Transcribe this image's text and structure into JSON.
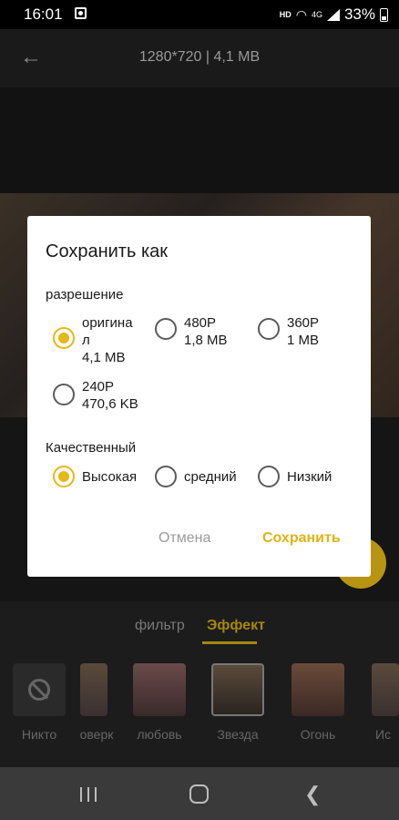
{
  "status_bar": {
    "time": "16:01",
    "net_type": "HD",
    "signal_gen": "4G",
    "battery": "33%"
  },
  "header": {
    "title": "1280*720 | 4,1 MB"
  },
  "bottom_panel": {
    "tabs": [
      {
        "label": "фильтр",
        "active": false
      },
      {
        "label": "Эффект",
        "active": true
      }
    ],
    "thumbnails": [
      {
        "label": "Никто"
      },
      {
        "label": "оверк"
      },
      {
        "label": "любовь"
      },
      {
        "label": "Звезда",
        "selected": true
      },
      {
        "label": "Огонь"
      },
      {
        "label": "Ис"
      }
    ]
  },
  "dialog": {
    "title": "Сохранить как",
    "resolution_label": "разрешение",
    "resolution_options": [
      {
        "line1": "оригина",
        "line2": "л",
        "line3": "4,1 MB",
        "selected": true
      },
      {
        "line1": "480P",
        "line2": "1,8 MB",
        "selected": false
      },
      {
        "line1": "360P",
        "line2": "1 MB",
        "selected": false
      },
      {
        "line1": "240P",
        "line2": "470,6 KB",
        "selected": false
      }
    ],
    "quality_label": "Качественный",
    "quality_options": [
      {
        "label": "Высокая",
        "selected": true
      },
      {
        "label": "средний",
        "selected": false
      },
      {
        "label": "Низкий",
        "selected": false
      }
    ],
    "cancel_label": "Отмена",
    "save_label": "Сохранить"
  },
  "colors": {
    "accent": "#E6B816",
    "dialog_bg": "#FFFFFF",
    "nav_bar": "#3A3A3A"
  }
}
